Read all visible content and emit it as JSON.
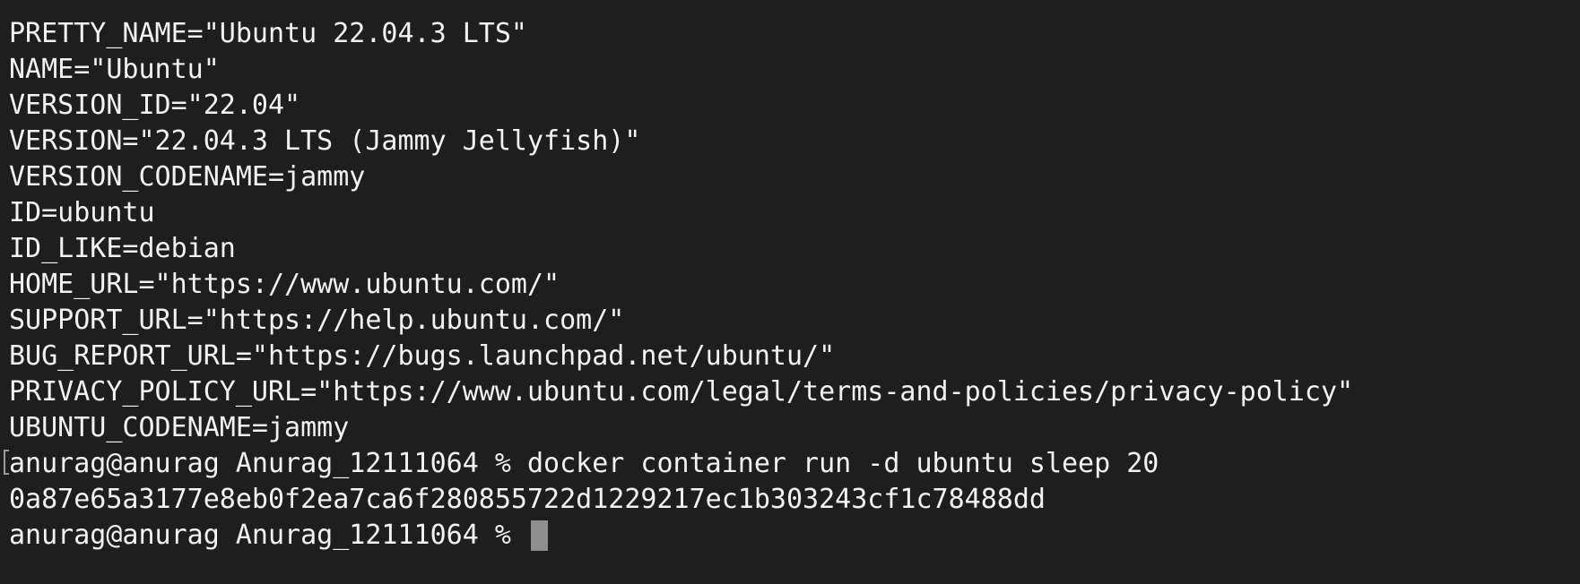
{
  "terminal": {
    "lines": [
      "PRETTY_NAME=\"Ubuntu 22.04.3 LTS\"",
      "NAME=\"Ubuntu\"",
      "VERSION_ID=\"22.04\"",
      "VERSION=\"22.04.3 LTS (Jammy Jellyfish)\"",
      "VERSION_CODENAME=jammy",
      "ID=ubuntu",
      "ID_LIKE=debian",
      "HOME_URL=\"https://www.ubuntu.com/\"",
      "SUPPORT_URL=\"https://help.ubuntu.com/\"",
      "BUG_REPORT_URL=\"https://bugs.launchpad.net/ubuntu/\"",
      "PRIVACY_POLICY_URL=\"https://www.ubuntu.com/legal/terms-and-policies/privacy-policy\"",
      "UBUNTU_CODENAME=jammy",
      "anurag@anurag Anurag_12111064 % docker container run -d ubuntu sleep 20",
      "0a87e65a3177e8eb0f2ea7ca6f280855722d1229217ec1b303243cf1c78488dd"
    ],
    "prompt": "anurag@anurag Anurag_12111064 % ",
    "colors": {
      "background": "#1e1e1e",
      "text": "#f2f2f2",
      "cursor": "#8e8e8e"
    }
  }
}
